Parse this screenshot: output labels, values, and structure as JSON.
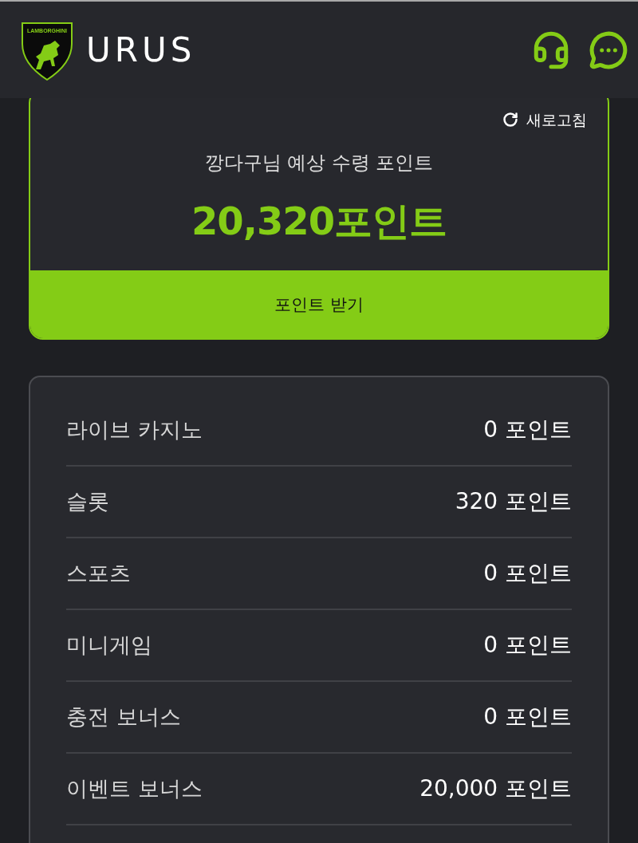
{
  "header": {
    "logo_text": "LAMBORGHINI",
    "title": "URUS"
  },
  "points_card": {
    "refresh_label": "새로고침",
    "title": "깡다구님 예상 수령 포인트",
    "amount": "20,320포인트",
    "button": "포인트 받기"
  },
  "breakdown": [
    {
      "label": "라이브 카지노",
      "value": "0 포인트"
    },
    {
      "label": "슬롯",
      "value": "320 포인트"
    },
    {
      "label": "스포츠",
      "value": "0 포인트"
    },
    {
      "label": "미니게임",
      "value": "0 포인트"
    },
    {
      "label": "충전 보너스",
      "value": "0 포인트"
    },
    {
      "label": "이벤트 보너스",
      "value": "20,000 포인트"
    }
  ]
}
